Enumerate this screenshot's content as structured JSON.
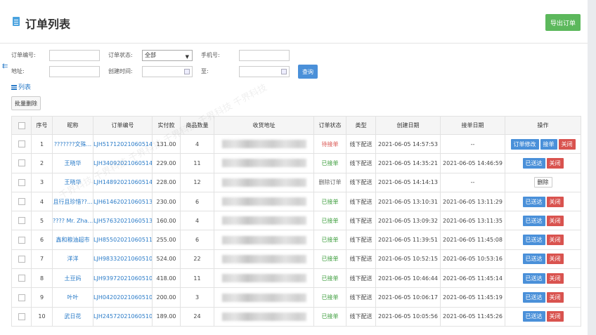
{
  "header": {
    "title": "订单列表",
    "export_label": "导出订单"
  },
  "filters": {
    "order_no_label": "订单编号:",
    "status_label": "订单状态:",
    "status_value": "全部",
    "phone_label": "手机号:",
    "address_label": "地址:",
    "created_label": "创建时间:",
    "to_label": "至:",
    "query_label": "查询"
  },
  "toolbar": {
    "list_label": "列表",
    "batch_delete_label": "批量删除"
  },
  "table": {
    "columns": [
      "序号",
      "昵称",
      "订单编号",
      "实付款",
      "商品数量",
      "收货地址",
      "订单状态",
      "类型",
      "创建日期",
      "接单日期",
      "操作"
    ],
    "rows": [
      {
        "no": "1",
        "nick": "???????文殊...",
        "order": "LJH517120210605146...",
        "pay": "131.00",
        "qty": "4",
        "status": "待接单",
        "status_type": "pending",
        "type": "线下配送",
        "created": "2021-06-05 14:57:53",
        "accepted": "--",
        "actions": [
          {
            "label": "订单修改",
            "style": "blue"
          },
          {
            "label": "接单",
            "style": "blue"
          },
          {
            "label": "关闭",
            "style": "red"
          }
        ]
      },
      {
        "no": "2",
        "nick": "王晓华",
        "order": "LJH340920210605143...",
        "pay": "229.00",
        "qty": "11",
        "status": "已接单",
        "status_type": "accepted",
        "type": "线下配送",
        "created": "2021-06-05 14:35:21",
        "accepted": "2021-06-05 14:46:59",
        "actions": [
          {
            "label": "已送达",
            "style": "blue"
          },
          {
            "label": "关闭",
            "style": "red"
          }
        ]
      },
      {
        "no": "3",
        "nick": "王晓华",
        "order": "LJH148920210605141...",
        "pay": "228.00",
        "qty": "12",
        "status": "删除订单",
        "status_type": "deleted",
        "type": "线下配送",
        "created": "2021-06-05 14:14:13",
        "accepted": "--",
        "actions": [
          {
            "label": "删除",
            "style": "ghost"
          }
        ]
      },
      {
        "no": "4",
        "nick": "且行且珍惜??...",
        "order": "LJH614620210605131...",
        "pay": "230.00",
        "qty": "6",
        "status": "已接单",
        "status_type": "accepted",
        "type": "线下配送",
        "created": "2021-06-05 13:10:31",
        "accepted": "2021-06-05 13:11:29",
        "actions": [
          {
            "label": "已送达",
            "style": "blue"
          },
          {
            "label": "关闭",
            "style": "red"
          }
        ]
      },
      {
        "no": "5",
        "nick": "???? Mr. Zha...",
        "order": "LJH576320210605130...",
        "pay": "160.00",
        "qty": "4",
        "status": "已接单",
        "status_type": "accepted",
        "type": "线下配送",
        "created": "2021-06-05 13:09:32",
        "accepted": "2021-06-05 13:11:35",
        "actions": [
          {
            "label": "已送达",
            "style": "blue"
          },
          {
            "label": "关闭",
            "style": "red"
          }
        ]
      },
      {
        "no": "6",
        "nick": "鑫和粮油超市",
        "order": "LJH855020210605113...",
        "pay": "255.00",
        "qty": "6",
        "status": "已接单",
        "status_type": "accepted",
        "type": "线下配送",
        "created": "2021-06-05 11:39:51",
        "accepted": "2021-06-05 11:45:08",
        "actions": [
          {
            "label": "已送达",
            "style": "blue"
          },
          {
            "label": "关闭",
            "style": "red"
          }
        ]
      },
      {
        "no": "7",
        "nick": "洋洋",
        "order": "LJH983320210605105...",
        "pay": "524.00",
        "qty": "22",
        "status": "已接单",
        "status_type": "accepted",
        "type": "线下配送",
        "created": "2021-06-05 10:52:15",
        "accepted": "2021-06-05 10:53:16",
        "actions": [
          {
            "label": "已送达",
            "style": "blue"
          },
          {
            "label": "关闭",
            "style": "red"
          }
        ]
      },
      {
        "no": "8",
        "nick": "土豆妈",
        "order": "LJH939720210605104...",
        "pay": "418.00",
        "qty": "11",
        "status": "已接单",
        "status_type": "accepted",
        "type": "线下配送",
        "created": "2021-06-05 10:46:44",
        "accepted": "2021-06-05 11:45:14",
        "actions": [
          {
            "label": "已送达",
            "style": "blue"
          },
          {
            "label": "关闭",
            "style": "red"
          }
        ]
      },
      {
        "no": "9",
        "nick": "叶叶",
        "order": "LJH042020210605100...",
        "pay": "200.00",
        "qty": "3",
        "status": "已接单",
        "status_type": "accepted",
        "type": "线下配送",
        "created": "2021-06-05 10:06:17",
        "accepted": "2021-06-05 11:45:19",
        "actions": [
          {
            "label": "已送达",
            "style": "blue"
          },
          {
            "label": "关闭",
            "style": "red"
          }
        ]
      },
      {
        "no": "10",
        "nick": "武日花",
        "order": "LJH245720210605100...",
        "pay": "189.00",
        "qty": "24",
        "status": "已接单",
        "status_type": "accepted",
        "type": "线下配送",
        "created": "2021-06-05 10:05:56",
        "accepted": "2021-06-05 11:45:26",
        "actions": [
          {
            "label": "已送达",
            "style": "blue"
          },
          {
            "label": "关闭",
            "style": "red"
          }
        ]
      }
    ]
  },
  "watermark": "千界科技 千界科技 千界科技 千界科技 千界科技 千界科技"
}
